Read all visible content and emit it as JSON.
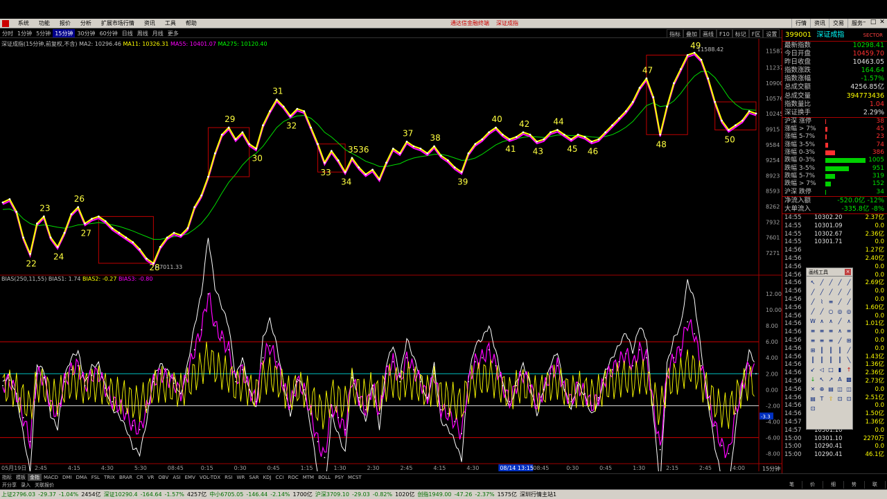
{
  "menubar": {
    "items": [
      "系统",
      "功能",
      "报价",
      "分析",
      "扩展市场行情",
      "资讯",
      "工具",
      "帮助"
    ],
    "center_items": [
      "通达信金融终端",
      "深证成指"
    ],
    "right_items": [
      "行情",
      "资讯",
      "交易",
      "服务"
    ]
  },
  "periods": [
    "分时",
    "1分钟",
    "5分钟",
    "15分钟",
    "30分钟",
    "60分钟",
    "日线",
    "周线",
    "月线",
    "更多"
  ],
  "active_period": 3,
  "tools": [
    "指标",
    "叠加",
    "画线",
    "F10",
    "标记",
    "F区",
    "设置"
  ],
  "ma_legend": {
    "title": "深证成指(15分钟,前复权,不含)",
    "ma2": "MA2: 10296.46",
    "ma11": "MA11: 10326.31",
    "ma55": "MA55: 10401.07",
    "ma275": "MA275: 10120.40"
  },
  "bias_legend": {
    "title": "BIAS(250,11,55)",
    "b1": "BIAS1: 1.74",
    "b2": "BIAS2: -0.27",
    "b3": "BIAS3: -0.80"
  },
  "chart_data": {
    "type": "line",
    "price_ticks": [
      "11587",
      "11237",
      "10900",
      "10576",
      "10245",
      "9915",
      "9584",
      "9254",
      "8923",
      "8593",
      "8262",
      "7932",
      "7601",
      "7271"
    ],
    "bias_ticks": [
      "12.00",
      "10.00",
      "8.00",
      "6.00",
      "4.00",
      "2.00",
      "0.00",
      "-2.00",
      "-4.00",
      "-6.00",
      "-8.00"
    ],
    "bias_current": "-3.3",
    "time_labels": [
      "05月19日",
      "2:45",
      "4:15",
      "4:30",
      "5:30",
      "08:45",
      "0:15",
      "0:30",
      "0:45",
      "1:15",
      "1:30",
      "2:30",
      "2:45",
      "4:15",
      "4:30",
      "08/14 13:15",
      "08:45",
      "0:30",
      "0:45",
      "1:30",
      "2:15",
      "2:45",
      "4:00"
    ],
    "wave_labels": [
      "22",
      "23",
      "24",
      "26",
      "27",
      "28",
      "29",
      "30",
      "31",
      "32",
      "33",
      "34",
      "3536",
      "37",
      "38",
      "39",
      "40",
      "41",
      "42",
      "43",
      "44",
      "45",
      "46",
      "47",
      "48",
      "49",
      "50"
    ],
    "high_label": "11588.42",
    "low_label": "7011.33",
    "price_range": [
      6900,
      11700
    ],
    "bias_range": [
      -9,
      14
    ],
    "price_series": [
      8350,
      8420,
      8150,
      7600,
      7250,
      7900,
      8050,
      7600,
      7400,
      7700,
      8100,
      8250,
      7900,
      8000,
      8050,
      7950,
      7800,
      7700,
      7600,
      7500,
      7350,
      7150,
      7050,
      7400,
      7600,
      7700,
      7650,
      7800,
      8250,
      8500,
      8900,
      9400,
      9800,
      9950,
      9700,
      9850,
      9600,
      9500,
      10000,
      10300,
      10550,
      10400,
      10200,
      10350,
      10300,
      9950,
      9600,
      9200,
      9450,
      9250,
      9000,
      9300,
      9100,
      8950,
      9050,
      8850,
      9200,
      9500,
      9400,
      9650,
      9550,
      9500,
      9400,
      9550,
      9350,
      9250,
      9100,
      9000,
      9400,
      9600,
      9700,
      9850,
      9950,
      9800,
      9700,
      9750,
      9850,
      9800,
      9650,
      9700,
      9850,
      9900,
      9800,
      9700,
      9800,
      9750,
      9650,
      9700,
      9850,
      10000,
      10150,
      10300,
      10500,
      10800,
      11000,
      10600,
      9800,
      10400,
      10900,
      11200,
      11500,
      11550,
      11400,
      11000,
      10500,
      10100,
      9900,
      10000,
      10100,
      10300,
      10250
    ],
    "ma_series": [
      8200,
      8210,
      8150,
      8000,
      7900,
      7850,
      7870,
      7850,
      7820,
      7800,
      7830,
      7870,
      7880,
      7900,
      7920,
      7900,
      7870,
      7840,
      7790,
      7740,
      7680,
      7620,
      7560,
      7560,
      7590,
      7620,
      7640,
      7680,
      7780,
      7900,
      8080,
      8300,
      8550,
      8780,
      8950,
      9150,
      9300,
      9400,
      9550,
      9750,
      9950,
      10080,
      10150,
      10200,
      10210,
      10150,
      10020,
      9850,
      9750,
      9620,
      9480,
      9400,
      9320,
      9230,
      9180,
      9120,
      9120,
      9150,
      9180,
      9250,
      9300,
      9330,
      9350,
      9380,
      9380,
      9350,
      9300,
      9250,
      9260,
      9300,
      9380,
      9480,
      9580,
      9650,
      9690,
      9710,
      9740,
      9760,
      9750,
      9740,
      9760,
      9790,
      9790,
      9780,
      9780,
      9770,
      9750,
      9740,
      9760,
      9800,
      9870,
      9960,
      10080,
      10250,
      10420,
      10480,
      10400,
      10420,
      10520,
      10680,
      10880,
      11050,
      11150,
      11150,
      11020,
      10820,
      10600,
      10450,
      10350,
      10330,
      10320
    ],
    "bias_series": [
      0.5,
      1.2,
      -0.5,
      -3.5,
      -6.5,
      2.0,
      1.5,
      -2.0,
      -3.0,
      1.0,
      2.5,
      3.0,
      0.5,
      1.8,
      2.0,
      0.2,
      -1.5,
      -2.0,
      -3.0,
      -4.5,
      -5.0,
      -2.5,
      1.0,
      2.0,
      1.5,
      0.8,
      -0.5,
      2.0,
      5.0,
      7.5,
      12.0,
      8.0,
      6.5,
      5.0,
      1.0,
      2.5,
      0.0,
      -1.5,
      4.0,
      5.5,
      3.5,
      0.5,
      -2.0,
      1.0,
      0.0,
      -3.0,
      -6.5,
      -8.5,
      -2.0,
      -3.5,
      -5.0,
      1.5,
      -1.0,
      -2.5,
      0.5,
      -3.0,
      2.0,
      3.5,
      1.0,
      4.0,
      2.5,
      1.0,
      -1.0,
      2.0,
      -2.5,
      -3.0,
      -4.0,
      -5.5,
      1.0,
      3.5,
      4.0,
      5.0,
      3.0,
      0.5,
      -1.5,
      0.5,
      2.0,
      0.5,
      -2.0,
      0.0,
      2.0,
      3.0,
      0.0,
      -1.5,
      0.5,
      -0.5,
      -2.0,
      -1.0,
      1.5,
      2.5,
      3.5,
      4.5,
      3.0,
      5.0,
      4.0,
      -2.0,
      -7.5,
      2.0,
      4.0,
      5.0,
      8.5,
      7.0,
      3.0,
      -1.0,
      -4.5,
      -7.0,
      -8.0,
      -3.0,
      0.5,
      3.0,
      2.0
    ]
  },
  "quote": {
    "code": "399001",
    "name": "深证成指",
    "tag": "SECTOR",
    "rows": [
      {
        "k": "最新指数",
        "v": "10298.41",
        "c": "grn"
      },
      {
        "k": "今日开盘",
        "v": "10459.70",
        "c": "red"
      },
      {
        "k": "昨日收盘",
        "v": "10463.05",
        "c": "wht"
      },
      {
        "k": "指数涨跌",
        "v": "164.64",
        "c": "grn"
      },
      {
        "k": "指数涨幅",
        "v": "-1.57%",
        "c": "grn"
      },
      {
        "k": "总成交额",
        "v": "4256.85亿",
        "c": "wht"
      },
      {
        "k": "总成交量",
        "v": "394773436",
        "c": "yel"
      },
      {
        "k": "指数量比",
        "v": "1.04",
        "c": "red"
      },
      {
        "k": "深证换手",
        "v": "2.29%",
        "c": "wht"
      }
    ],
    "breadth": [
      {
        "k": "沪深 涨停",
        "v": "38",
        "c": "red",
        "w": 0,
        "bc": "#ff3030"
      },
      {
        "k": "涨幅 > 7%",
        "v": "45",
        "c": "red",
        "w": 2,
        "bc": "#ff3030"
      },
      {
        "k": "涨幅 5-7%",
        "v": "23",
        "c": "red",
        "w": 1,
        "bc": "#ff3030"
      },
      {
        "k": "涨幅 3-5%",
        "v": "74",
        "c": "red",
        "w": 3,
        "bc": "#ff3030"
      },
      {
        "k": "涨幅 0-3%",
        "v": "386",
        "c": "red",
        "w": 12,
        "bc": "#ff3030"
      },
      {
        "k": "跌幅 0-3%",
        "v": "1005",
        "c": "grn",
        "w": 52,
        "bc": "#00d000"
      },
      {
        "k": "跌幅 3-5%",
        "v": "951",
        "c": "grn",
        "w": 30,
        "bc": "#00d000"
      },
      {
        "k": "跌幅 5-7%",
        "v": "319",
        "c": "grn",
        "w": 12,
        "bc": "#00d000"
      },
      {
        "k": "跌幅 > 7%",
        "v": "152",
        "c": "grn",
        "w": 6,
        "bc": "#00d000"
      },
      {
        "k": "沪深 跌停",
        "v": "34",
        "c": "grn",
        "w": 0,
        "bc": "#00d000"
      }
    ],
    "flow": [
      {
        "k": "净流入额",
        "v": "-520.0亿  -12%",
        "c": "grn"
      },
      {
        "k": "大单流入",
        "v": "-335.8亿  -8%",
        "c": "grn"
      }
    ],
    "trades": [
      {
        "t": "14:55",
        "p": "10302.20",
        "v": "2.37亿",
        "pc": "grn"
      },
      {
        "t": "14:55",
        "p": "10301.09",
        "v": "0.0",
        "pc": "grn"
      },
      {
        "t": "14:55",
        "p": "10302.67",
        "v": "2.36亿",
        "pc": "grn"
      },
      {
        "t": "14:55",
        "p": "10301.71",
        "v": "0.0",
        "pc": "grn"
      },
      {
        "t": "14:56",
        "p": "",
        "v": "1.27亿",
        "pc": "grn"
      },
      {
        "t": "14:56",
        "p": "",
        "v": "2.40亿",
        "pc": "grn"
      },
      {
        "t": "14:56",
        "p": "",
        "v": "0.0",
        "pc": "grn"
      },
      {
        "t": "14:56",
        "p": "",
        "v": "0.0",
        "pc": "grn"
      },
      {
        "t": "14:56",
        "p": "",
        "v": "2.69亿",
        "pc": "grn"
      },
      {
        "t": "14:56",
        "p": "",
        "v": "0.0",
        "pc": "grn"
      },
      {
        "t": "14:56",
        "p": "",
        "v": "0.0",
        "pc": "grn"
      },
      {
        "t": "14:56",
        "p": "",
        "v": "1.60亿",
        "pc": "grn"
      },
      {
        "t": "14:56",
        "p": "",
        "v": "0.0",
        "pc": "grn"
      },
      {
        "t": "14:56",
        "p": "",
        "v": "1.01亿",
        "pc": "grn"
      },
      {
        "t": "14:56",
        "p": "",
        "v": "0.0",
        "pc": "grn"
      },
      {
        "t": "14:56",
        "p": "",
        "v": "0.0",
        "pc": "grn"
      },
      {
        "t": "14:56",
        "p": "",
        "v": "0.0",
        "pc": "grn"
      },
      {
        "t": "14:56",
        "p": "",
        "v": "1.43亿",
        "pc": "grn"
      },
      {
        "t": "14:56",
        "p": "",
        "v": "1.36亿",
        "pc": "grn"
      },
      {
        "t": "14:56",
        "p": "",
        "v": "2.36亿",
        "pc": "grn"
      },
      {
        "t": "14:56",
        "p": "",
        "v": "2.73亿",
        "pc": "grn"
      },
      {
        "t": "14:56",
        "p": "",
        "v": "0.0",
        "pc": "grn"
      },
      {
        "t": "14:56",
        "p": "",
        "v": "2.51亿",
        "pc": "grn"
      },
      {
        "t": "14:56",
        "p": "",
        "v": "0.0",
        "pc": "grn"
      },
      {
        "t": "14:56",
        "p": "",
        "v": "1.50亿",
        "pc": "grn"
      },
      {
        "t": "14:57",
        "p": "10301.11",
        "v": "1.36亿",
        "pc": "grn"
      },
      {
        "t": "14:57",
        "p": "10301.10",
        "v": "0.0",
        "pc": "grn"
      },
      {
        "t": "15:00",
        "p": "10301.10",
        "v": "2270万",
        "pc": "grn"
      },
      {
        "t": "15:00",
        "p": "10290.41",
        "v": "0.0",
        "pc": "grn"
      },
      {
        "t": "15:00",
        "p": "10290.41",
        "v": "46.1亿",
        "pc": "grn"
      }
    ]
  },
  "drawpanel": {
    "title": "画线工具",
    "close": "×",
    "tools": [
      "↖",
      "╱",
      "╱",
      "╱",
      "╱",
      "╱",
      "╱",
      "╱",
      "╱",
      "╱",
      "╱",
      "⌇",
      "≡",
      "╱",
      "╱",
      "╱",
      "╱",
      "○",
      "◎",
      "◎",
      "W",
      "∧",
      "∧",
      "╱",
      "∧",
      "≡",
      "≡",
      "≡",
      "∧",
      "≡",
      "≡",
      "≡",
      "≡",
      "╱",
      "⊞",
      "⊞",
      "║",
      "║",
      "║",
      "╱",
      "║",
      "║",
      "║",
      "║",
      "╲",
      "↙",
      "◁",
      "□",
      "▮",
      "↑",
      "↓",
      "↖",
      "↗",
      "A",
      "▩",
      "✕",
      "⊕",
      "▤",
      "◫",
      "◫",
      "▤",
      "T",
      "⇧",
      "⊡",
      "⊡",
      "⊡"
    ]
  },
  "indicator_tabs": [
    "指标",
    "模板",
    "金指",
    "MACD",
    "DMI",
    "DMA",
    "FSL",
    "TRIX",
    "BRAR",
    "CR",
    "VR",
    "OBV",
    "ASI",
    "EMV",
    "VOL-TDX",
    "RSI",
    "WR",
    "SAR",
    "KDJ",
    "CCI",
    "ROC",
    "MTM",
    "BOLL",
    "PSY",
    "MCST"
  ],
  "active_tab": 2,
  "sub_tabs": [
    "开分享",
    "录入",
    "关联报价"
  ],
  "page_info": "15分钟",
  "quote_tabs": [
    "笔",
    "价",
    "细",
    "势",
    "联"
  ],
  "statusbar": [
    {
      "label": "上证",
      "value": "2796.03",
      "c": "grn"
    },
    {
      "label": "",
      "value": "-29.37",
      "c": "grn"
    },
    {
      "label": "",
      "value": "-1.04%",
      "c": "grn"
    },
    {
      "label": "",
      "value": "2454亿",
      "c": "wht"
    },
    {
      "label": "深证",
      "value": "10290.4",
      "c": "grn"
    },
    {
      "label": "",
      "value": "-164.64",
      "c": "grn"
    },
    {
      "label": "",
      "value": "-1.57%",
      "c": "grn"
    },
    {
      "label": "",
      "value": "4257亿",
      "c": "wht"
    },
    {
      "label": "中小",
      "value": "6705.05",
      "c": "grn"
    },
    {
      "label": "",
      "value": "-146.44",
      "c": "grn"
    },
    {
      "label": "",
      "value": "-2.14%",
      "c": "grn"
    },
    {
      "label": "",
      "value": "1700亿",
      "c": "wht"
    },
    {
      "label": "沪深",
      "value": "3709.10",
      "c": "grn"
    },
    {
      "label": "",
      "value": "-29.03",
      "c": "grn"
    },
    {
      "label": "",
      "value": "-0.82%",
      "c": "grn"
    },
    {
      "label": "",
      "value": "1020亿",
      "c": "wht"
    },
    {
      "label": "创指",
      "value": "1949.00",
      "c": "grn"
    },
    {
      "label": "",
      "value": "-47.26",
      "c": "grn"
    },
    {
      "label": "",
      "value": "-2.37%",
      "c": "grn"
    },
    {
      "label": "",
      "value": "1575亿",
      "c": "wht"
    },
    {
      "label": "",
      "value": "深圳行情主站1",
      "c": "blk"
    }
  ]
}
